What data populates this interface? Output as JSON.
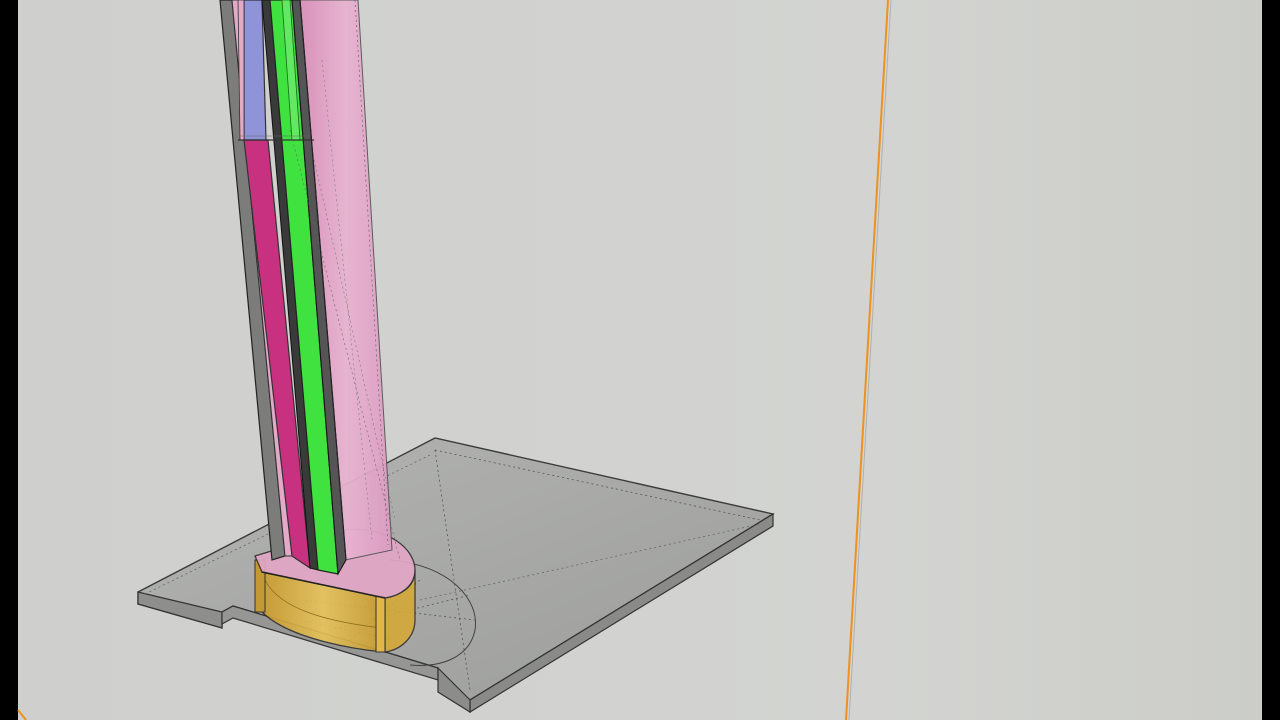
{
  "app": {
    "type": "3d-modeling-viewport"
  },
  "viewport": {
    "background_color": "#cfd0cd",
    "letterbox_color": "#000000",
    "axis_color": "#f0901e"
  },
  "model": {
    "tube_colors": {
      "pink_shell": "#e3a9c8",
      "magenta_strip": "#c8317f",
      "green_strip": "#3fe23f",
      "blue_strip": "#8f94d8",
      "gold_base": "#d9b141",
      "slab": "#a9aaa8"
    }
  }
}
